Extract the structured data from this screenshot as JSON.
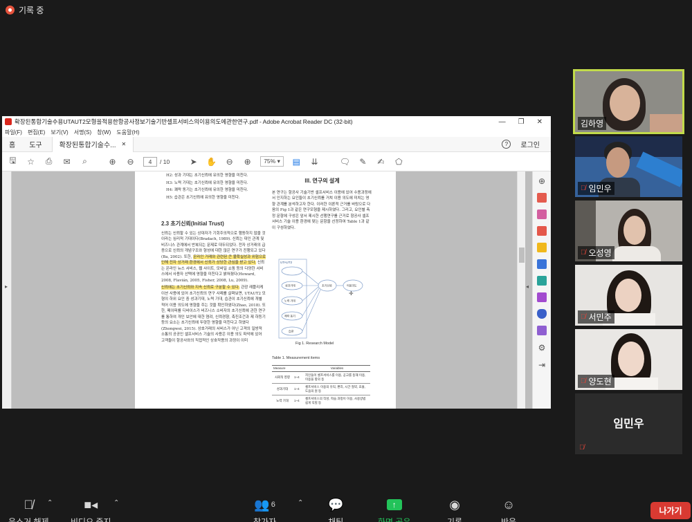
{
  "recording": {
    "label": "기록 중"
  },
  "acrobat": {
    "window_title": "확장된통합기술수용UTAUT2모형을적용한항공사정보기술기반셀프서비스의이용의도에관한연구.pdf - Adobe Acrobat Reader DC (32-bit)",
    "menu": [
      "파일(F)",
      "편집(E)",
      "보기(V)",
      "서명(S)",
      "창(W)",
      "도움말(H)"
    ],
    "tabs": {
      "home": "홈",
      "tools": "도구",
      "doc": "확장된통합기술수..."
    },
    "login": "로그인",
    "page_current": "4",
    "page_total": "/ 10",
    "zoom": "75%",
    "page": {
      "left_items": [
        "H2: 성과 기대는 초기신뢰에 유의한 영향을 미친다.",
        "H3: 노력 기대는 초기신뢰에 유의한 영향을 미친다.",
        "H4: 쾌락 동기는 초기신뢰에 유의한 영향을 미친다.",
        "H5: 습관은 초기신뢰에 유의한 영향을 미친다."
      ],
      "left_heading": "2.3 초기신뢰(Initial Trust)",
      "left_para1": "신뢰는 신뢰할 수 있는 상대자가 기회주의적으로 행동하지 않을 것이라는 심리적 기대이다(Bradach, 1989). 신뢰는 대인 관계 및 비즈니스 관계에서 반복되는 문제로 대두되었다. 전자 상거래의 급증으로 신뢰의 개념구조와 형성에 대한 많은 연구가 진행되고 있다(Ba, 2002). 또한,",
      "left_hl1": "온라인 거래와 관련된 큰 불확실성과 위험으로 인해 전자 상거래 환경에서 신뢰가 상당한 관심을 받고 있다.",
      "left_para1b": "신뢰는 온라인 뉴스 서비스, 웹 사이트, 모바일 쇼핑 등의 다양한 서비스에서 사용자 선택에 영향을 미친다고 밝혀졌다(Howard, 2008, Flavián, 2005, Fisher, 2008, Lu, 2009).",
      "left_hl2": "신뢰에는 초기신뢰와 지속 신뢰로 구분할 수 있다.",
      "left_para2": "관광 레플리케이션 사용에 있어 초기신뢰의 연구 사례를 살펴보면, UTAUT2 모형의 하위 요인 중 성과기대, 노력 기대, 습관이 초기신뢰에 개별 적어 이용 의도에 영향을 주는 것을 확인하였다(Zhao, 2018). 또한, 페이퍼를 디바이스가 비즈니스 소비자의 초기신뢰에 관한 연구를 통하여 개인 보안에 대한 염려, 신뢰경향, 촉진조건과 제 하등기 등의 요소는 초기신뢰에 뚜렷한 영향을 미친다고 하였다(Zhongwei, 2015). 상호거래의 서비스가 아닌 고객의 일방적 소통의 공공인 셀프서비스 기술의 사용은 이용 의도 파악에 있어 고객들이 항공사와의 직접적인 상호작용의 과정이 이미",
      "right_heading": "III. 연구의 설계",
      "right_para": "본 연구는 항공사 기술기반 셀프서비스 이용에 있어 수용과정에서 인지하는 요인들이 초기신뢰를 거쳐 이용 의도에 미치는 영향 관계를 분석하고자 한다. 이러한 이론적 근거를 바탕으로 다음의 Fig 1과 같은 연구모형을 제시하였다. 그리고, 요인별 측정 문항에 구성은 앞서 제시한 선행연구를 근거로 항공사 셀프서비스 기술 이용 환경에 맞는 문항을 선정하여 Table 1과 같이 구성하였다.",
      "model_top": "UTAUT2",
      "model_boxes": [
        "성과기대",
        "노력 기대",
        "쾌락 동기",
        "습관",
        "초기신뢰",
        "이용의도"
      ],
      "fig_caption": "Fig 1. Research Model",
      "table_title": "Table 1. Measurement items",
      "table_header": [
        "Measure",
        "Variables"
      ],
      "table_rows": [
        [
          "사회적 영향",
          "1~4",
          "지인들이 셀프서비스를 이용, 공고를 등해 이용, 이용을 항의 등"
        ],
        [
          "성과기대",
          "1~4",
          "셀프서비스 이용의 유익, 편리, 시간 절약, 효율, 도움의 원 등"
        ],
        [
          "노력 기대",
          "1~4",
          "셀프서비스의 작성, 학습 과정이 이용, 사용방법 쉽게 익힐 등"
        ]
      ]
    }
  },
  "participants": [
    {
      "name": "김하영",
      "muted": false,
      "active": true
    },
    {
      "name": "임민우",
      "muted": true,
      "active": false
    },
    {
      "name": "오성영",
      "muted": true,
      "active": false
    },
    {
      "name": "서민주",
      "muted": true,
      "active": false
    },
    {
      "name": "양도현",
      "muted": true,
      "active": false
    },
    {
      "name": "임민우",
      "muted": true,
      "active": false,
      "video_off": true
    }
  ],
  "bottom": {
    "audio": "음소거 해제",
    "video": "비디오 중지",
    "participants": "참가자",
    "participant_count": "6",
    "chat": "채팅",
    "share": "화면 공유",
    "record": "기록",
    "reactions": "반응",
    "leave": "나가기"
  },
  "colors": {
    "share_green": "#23c35a",
    "leave_red": "#d93a32",
    "active_border": "#c2db4a",
    "highlight": "#fbe67a"
  }
}
